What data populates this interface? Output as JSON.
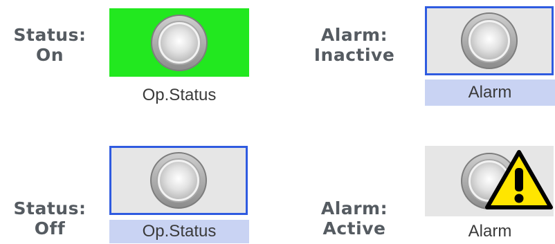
{
  "states": {
    "status_on": {
      "line1": "Status:",
      "line2": "On"
    },
    "status_off": {
      "line1": "Status:",
      "line2": "Off"
    },
    "alarm_inactive": {
      "line1": "Alarm:",
      "line2": "Inactive"
    },
    "alarm_active": {
      "line1": "Alarm:",
      "line2": "Active"
    }
  },
  "indicators": {
    "status_on": {
      "caption": "Op.Status",
      "fill": "#22e81f",
      "selected": false,
      "lamp_icon": "lamp-icon"
    },
    "status_off": {
      "caption": "Op.Status",
      "fill": "#e6e6e6",
      "selected": true,
      "lamp_icon": "lamp-icon"
    },
    "alarm_inactive": {
      "caption": "Alarm",
      "fill": "#e6e6e6",
      "selected": true,
      "lamp_icon": "lamp-icon"
    },
    "alarm_active": {
      "caption": "Alarm",
      "fill": "#e6e6e6",
      "selected": false,
      "lamp_icon": "lamp-icon",
      "warning_icon": "warning-triangle-icon"
    }
  },
  "colors": {
    "label_text": "#555b61",
    "selection_border": "#2f5be0",
    "caption_highlight": "#c9d3f3",
    "on_green": "#22e81f",
    "off_gray": "#e6e6e6",
    "warning_yellow": "#ffe500"
  }
}
